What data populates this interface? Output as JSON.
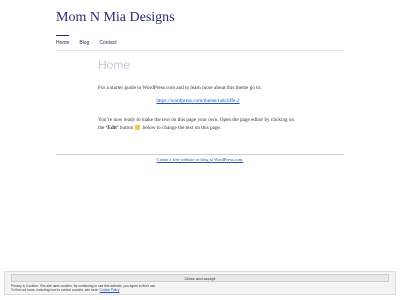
{
  "site": {
    "title": "Mom N Mia Designs"
  },
  "nav": {
    "items": [
      "Home",
      "Blog",
      "Contact"
    ]
  },
  "page": {
    "title": "Home",
    "para1": "For a starter guide to WordPress.com and to learn more about this theme go to:",
    "link": "https://wordpress.com/theme/radcliffe-2",
    "para2_a": "You’re now ready to make the text on this page your own. Open the page editor by clicking on the ",
    "para2_edit": "‘Edit’",
    "para2_b": " button ",
    "para2_c": " below to change the text on this page."
  },
  "footer": {
    "link": "Create a free website or blog at WordPress.com."
  },
  "cookie": {
    "close_label": "Close and accept",
    "line1": "Privacy & Cookies: This site uses cookies. By continuing to use this website, you agree to their use.",
    "line2": "To find out more, including how to control cookies, see here: ",
    "policy_link": "Cookie Policy"
  },
  "icons": {
    "edit": "pencil-icon"
  }
}
